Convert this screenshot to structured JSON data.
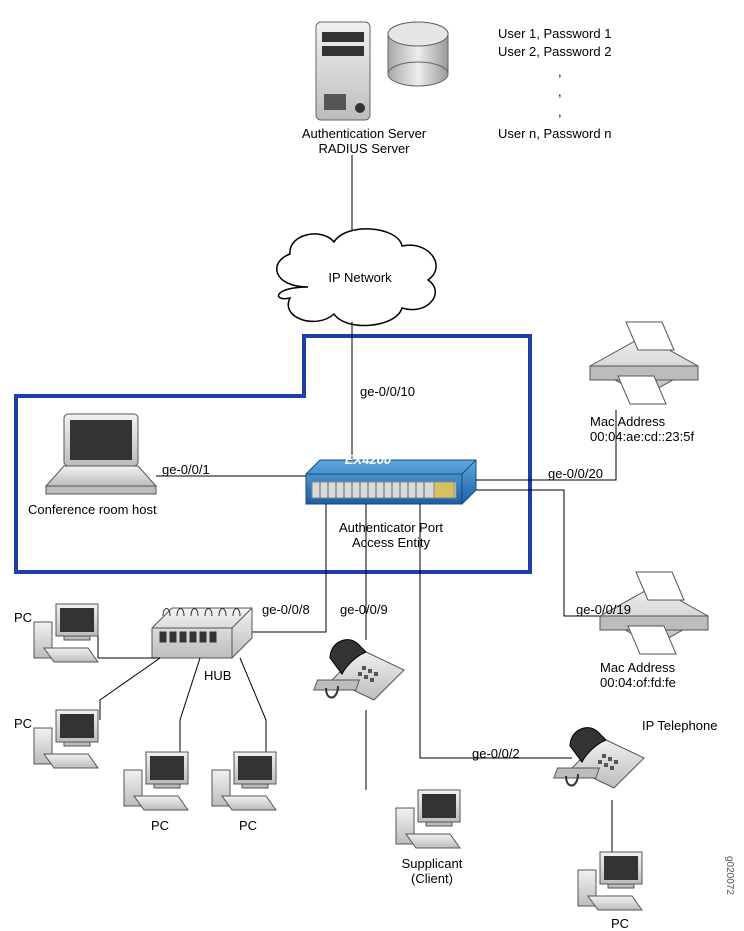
{
  "server": {
    "label_line1": "Authentication Server",
    "label_line2": "RADIUS Server"
  },
  "users": {
    "line1": "User 1,  Password 1",
    "line2": "User 2,  Password 2",
    "dot": ",",
    "lineN": "User n,  Password n"
  },
  "cloud": {
    "label": "IP Network"
  },
  "switch": {
    "model": "EX4200",
    "label_line1": "Authenticator Port",
    "label_line2": "Access Entity"
  },
  "laptop": {
    "label": "Conference room host"
  },
  "ports": {
    "uplink": "ge-0/0/10",
    "laptop": "ge-0/0/1",
    "hub": "ge-0/0/8",
    "phone_supplicant": "ge-0/0/9",
    "printer_top": "ge-0/0/20",
    "printer_bottom": "ge-0/0/19",
    "ip_phone": "ge-0/0/2"
  },
  "printer_top": {
    "label_line1": "Mac Address",
    "label_line2": "00:04:ae:cd::23:5f"
  },
  "printer_bottom": {
    "label_line1": "Mac Address",
    "label_line2": "00:04:of:fd:fe"
  },
  "hub": {
    "label": "HUB"
  },
  "pc_label": "PC",
  "supplicant": {
    "label_line1": "Supplicant",
    "label_line2": "(Client)"
  },
  "ip_phone": {
    "label": "IP Telephone"
  },
  "figure_id": "g020072"
}
